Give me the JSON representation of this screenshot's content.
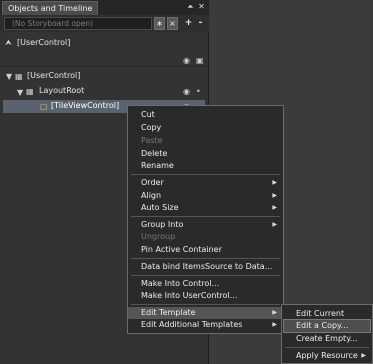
{
  "panel": {
    "tab_title": "Objects and Timeline",
    "pin_icon": "pin-icon",
    "close_icon": "close-icon",
    "storyboard_placeholder": "(No Storyboard open)",
    "scope_title": "[UserControl]",
    "tree": {
      "root": "[UserControl]",
      "layout_root": "LayoutRoot",
      "selected": "[TileViewControl]"
    }
  },
  "context_menu": {
    "cut": "Cut",
    "copy": "Copy",
    "paste": "Paste",
    "delete": "Delete",
    "rename": "Rename",
    "order": "Order",
    "align": "Align",
    "auto_size": "Auto Size",
    "group_into": "Group Into",
    "ungroup": "Ungroup",
    "pin_active_container": "Pin Active Container",
    "data_bind": "Data bind ItemsSource to Data...",
    "make_into_control": "Make Into Control...",
    "make_into_usercontrol": "Make Into UserControl...",
    "edit_template": "Edit Template",
    "edit_additional_templates": "Edit Additional Templates"
  },
  "submenu": {
    "edit_current": "Edit Current",
    "edit_a_copy": "Edit a Copy...",
    "create_empty": "Create Empty...",
    "apply_resource": "Apply Resource"
  }
}
